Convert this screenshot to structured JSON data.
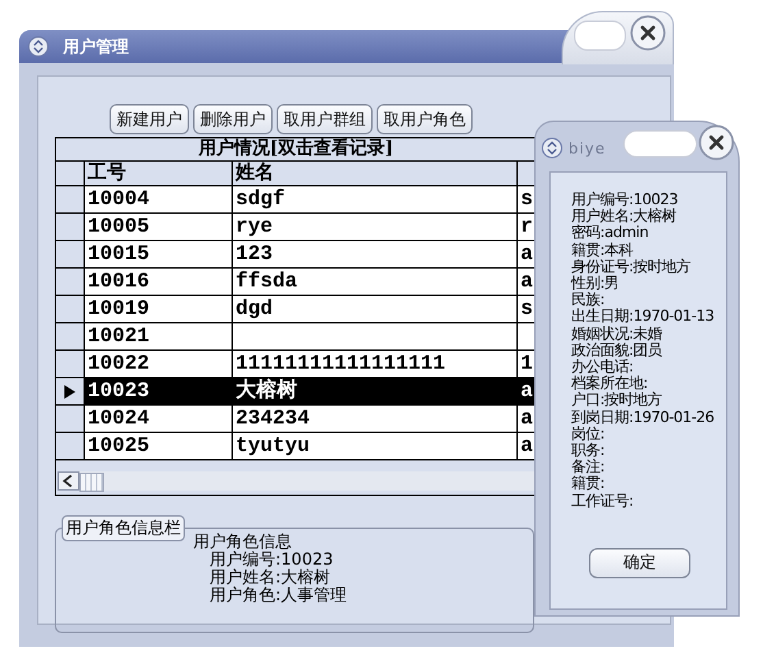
{
  "window": {
    "title": "用户管理"
  },
  "toolbar": {
    "buttons": [
      "新建用户",
      "删除用户",
      "取用户群组",
      "取用户角色"
    ]
  },
  "table": {
    "caption": "用户情况[双击查看记录]",
    "columns": [
      "工号",
      "姓名"
    ],
    "rows": [
      {
        "cells": [
          "10004",
          "sdgf",
          "s"
        ],
        "selected": false
      },
      {
        "cells": [
          "10005",
          "rye",
          "r"
        ],
        "selected": false
      },
      {
        "cells": [
          "10015",
          "123",
          "a"
        ],
        "selected": false
      },
      {
        "cells": [
          "10016",
          "ffsda",
          "a"
        ],
        "selected": false
      },
      {
        "cells": [
          "10019",
          "dgd",
          "s"
        ],
        "selected": false
      },
      {
        "cells": [
          "10021"
        ],
        "selected": false
      },
      {
        "cells": [
          "10022",
          "11111111111111111",
          "1"
        ],
        "selected": false
      },
      {
        "cells": [
          "10023",
          "大榕树",
          "a"
        ],
        "selected": true
      },
      {
        "cells": [
          "10024",
          "234234",
          "a"
        ],
        "selected": false
      },
      {
        "cells": [
          "10025",
          "tyutyu",
          "a"
        ],
        "selected": false
      }
    ]
  },
  "role_group": {
    "legend": "用户角色信息栏",
    "heading": "用户角色信息",
    "lines": [
      "用户编号:10023",
      "用户姓名:大榕树",
      "用户角色:人事管理"
    ]
  },
  "dialog": {
    "title": "biye",
    "lines": [
      "用户编号:10023",
      "用户姓名:大榕树",
      "密码:admin",
      "籍贯:本科",
      "身份证号:按时地方",
      "性别:男",
      "民族:",
      "出生日期:1970-01-13",
      "婚姻状况:未婚",
      "政治面貌:团员",
      "办公电话:",
      "档案所在地:",
      "户口:按时地方",
      "到岗日期:1970-01-26",
      "岗位:",
      "职务:",
      "备注:",
      "籍贯:",
      "工作证号:"
    ],
    "button": "确定"
  }
}
